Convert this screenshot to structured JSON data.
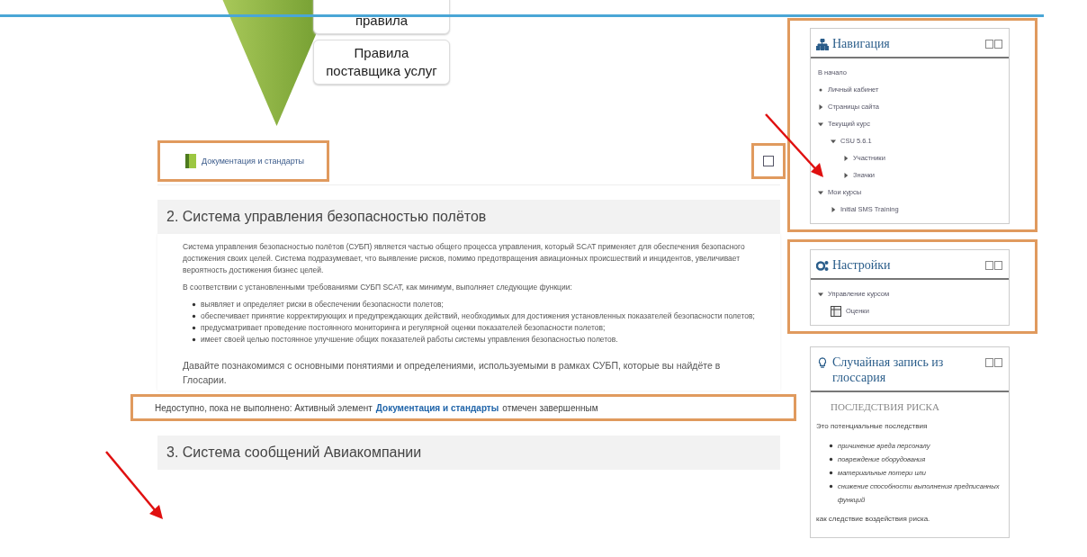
{
  "diagram": {
    "boxes": [
      "правила",
      "Правила\nпоставщика услуг"
    ]
  },
  "activity": {
    "label": "Документация и стандарты",
    "completed": false
  },
  "sections": [
    {
      "title": "2. Система управления безопасностью полётов",
      "paragraphs": [
        "Система управления безопасностью полётов (СУБП) является частью общего процесса управления, который SCAT применяет для обеспечения безопасного достижения своих целей. Система подразумевает, что выявление рисков, помимо предотвращения авиационных происшествий и инцидентов, увеличивает вероятность достижения бизнес целей.",
        "В соответствии с установленными требованиями СУБП SCAT, как минимум, выполняет следующие функции:"
      ],
      "bullets": [
        "выявляет и определяет риски в обеспечении безопасности полетов;",
        "обеспечивает принятие корректирующих и предупреждающих действий, необходимых для достижения установленных показателей безопасности полетов;",
        "предусматривает проведение постоянного мониторинга и регулярной оценки показателей безопасности полетов;",
        "имеет своей целью постоянное улучшение общих показателей работы системы управления безопасностью полетов."
      ],
      "closing": "Давайте познакомимся с основными понятиями и определениями, используемыми в рамках СУБП, которые вы найдёте в Глосарии.",
      "restriction": {
        "prefix": "Недоступно, пока не выполнено: Активный элемент",
        "link": "Документация и стандарты",
        "suffix": "отмечен завершенным"
      }
    },
    {
      "title": "3. Система сообщений Авиакомпании"
    }
  ],
  "navigation": {
    "title": "Навигация",
    "items": [
      {
        "label": "В начало",
        "kind": "home"
      },
      {
        "label": "Личный кабинет",
        "kind": "bullet"
      },
      {
        "label": "Страницы сайта",
        "kind": "branch",
        "expanded": false
      },
      {
        "label": "Текущий курс",
        "kind": "branch",
        "expanded": true,
        "children": [
          {
            "label": "CSU 5.6.1",
            "kind": "branch",
            "expanded": true,
            "children": [
              {
                "label": "Участники",
                "kind": "branch",
                "expanded": false
              },
              {
                "label": "Значки",
                "kind": "branch",
                "expanded": false
              }
            ]
          }
        ]
      },
      {
        "label": "Мои курсы",
        "kind": "branch",
        "expanded": true,
        "children": [
          {
            "label": "Initial SMS Training",
            "kind": "branch",
            "expanded": false
          }
        ]
      }
    ]
  },
  "settings": {
    "title": "Настройки",
    "items": [
      {
        "label": "Управление курсом",
        "kind": "branch",
        "expanded": true,
        "children": [
          {
            "label": "Оценки",
            "kind": "grades"
          }
        ]
      }
    ]
  },
  "glossary": {
    "title": "Случайная запись из глоссария",
    "concept": "ПОСЛЕДСТВИЯ РИСКА",
    "intro": "Это потенциальные последствия",
    "bullets": [
      "причинение вреда персоналу",
      "повреждение оборудования",
      "материальные потери или",
      "снижение способности выполнения предписанных функций"
    ],
    "outro": "как следствие воздействия риска."
  }
}
